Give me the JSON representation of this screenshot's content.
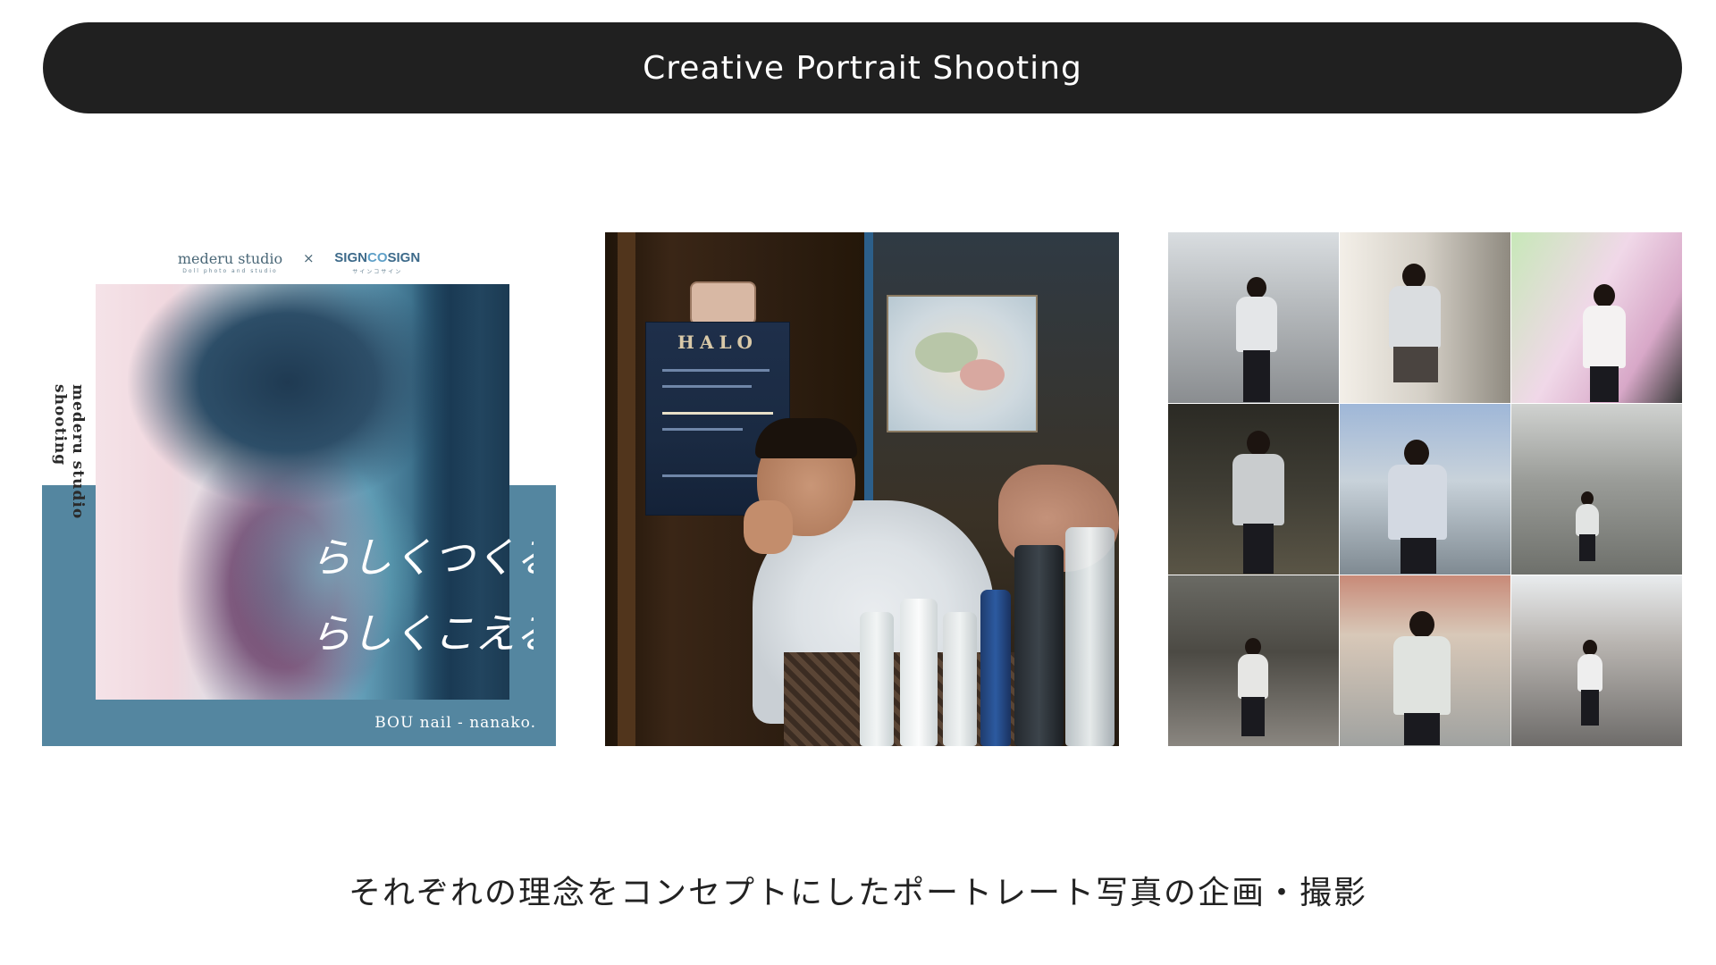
{
  "header": {
    "title": "Creative Portrait Shooting"
  },
  "works": [
    {
      "logos": {
        "left": "mederu studio",
        "left_sub": "Doll photo and studio",
        "separator": "×",
        "right_prefix": "SIGN",
        "right_mark": "CO",
        "right_suffix": "SIGN",
        "right_sub": "サインコサイン"
      },
      "vertical_text": "mederu studio shooting",
      "handwriting_line1": "らしくつくる。",
      "handwriting_line2": "らしくこえる。",
      "caption": "BOU nail - nanako."
    },
    {
      "poster_title": "HALO"
    },
    {}
  ],
  "footer": {
    "description": "それぞれの理念をコンセプトにしたポートレート写真の企画・撮影"
  },
  "colors": {
    "title_bar": "#202020",
    "poster_band": "#5486a0",
    "text": "#222222"
  }
}
